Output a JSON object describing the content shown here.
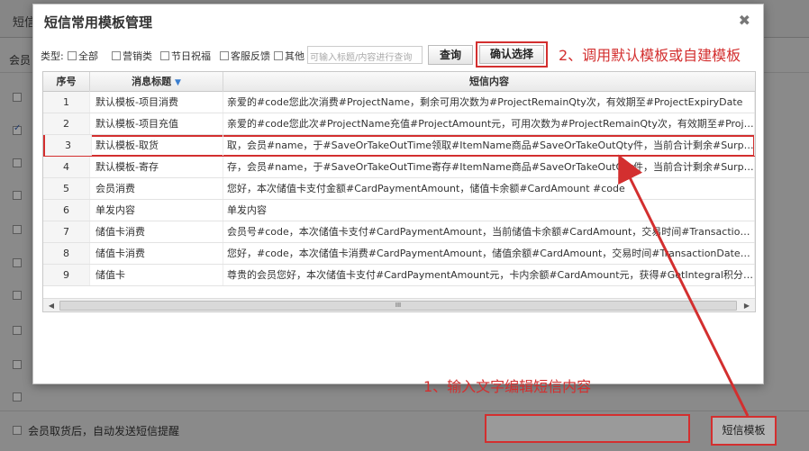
{
  "background": {
    "title": "短信",
    "tab": "会员",
    "footer_checkbox_label": "会员取货后，自动发送短信提醒",
    "sms_template_button": "短信模板"
  },
  "modal": {
    "title": "短信常用模板管理",
    "close": "✖",
    "filter": {
      "type_label": "类型:",
      "options": [
        "全部",
        "营销类",
        "节日祝福",
        "客服反馈",
        "其他"
      ],
      "search_placeholder": "可输入标题/内容进行查询",
      "query_button": "查询",
      "confirm_button": "确认选择"
    },
    "table": {
      "headers": [
        "序号",
        "消息标题",
        "短信内容"
      ],
      "rows": [
        {
          "num": "1",
          "title": "默认模板-项目消费",
          "content": "亲爱的#code您此次消费#ProjectName，剩余可用次数为#ProjectRemainQty次，有效期至#ProjectExpiryDate"
        },
        {
          "num": "2",
          "title": "默认模板-项目充值",
          "content": "亲爱的#code您此次#ProjectName充值#ProjectAmount元，可用次数为#ProjectRemainQty次，有效期至#ProjectExpi..."
        },
        {
          "num": "3",
          "title": "默认模板-取货",
          "content": "取，会员#name，于#SaveOrTakeOutTime领取#ItemName商品#SaveOrTakeOutQty件，当前合计剩余#SurplusSave..."
        },
        {
          "num": "4",
          "title": "默认模板-寄存",
          "content": "存，会员#name，于#SaveOrTakeOutTime寄存#ItemName商品#SaveOrTakeOutQty件，当前合计剩余#SurplusSave..."
        },
        {
          "num": "5",
          "title": "会员消费",
          "content": "您好，本次储值卡支付金额#CardPaymentAmount，储值卡余额#CardAmount #code"
        },
        {
          "num": "6",
          "title": "单发内容",
          "content": "单发内容"
        },
        {
          "num": "7",
          "title": "储值卡消费",
          "content": "会员号#code，本次储值卡支付#CardPaymentAmount，当前储值卡余额#CardAmount，交易时间#TransactionDate..."
        },
        {
          "num": "8",
          "title": "储值卡消费",
          "content": "您好，#code，本次储值卡消费#CardPaymentAmount，储值余额#CardAmount，交易时间#TransactionDate，谢谢..."
        },
        {
          "num": "9",
          "title": "储值卡",
          "content": "尊贵的会员您好，本次储值卡支付#CardPaymentAmount元，卡内余额#CardAmount元，获得#GetIntegral积分，当前..."
        }
      ],
      "scroll_thumb": "III"
    }
  },
  "annotations": {
    "step1": "1、输入文字编辑短信内容",
    "step2": "2、调用默认模板或自建模板"
  },
  "colors": {
    "annotation_red": "#d32f2f",
    "overlay_gray": "#8a8a8a"
  }
}
